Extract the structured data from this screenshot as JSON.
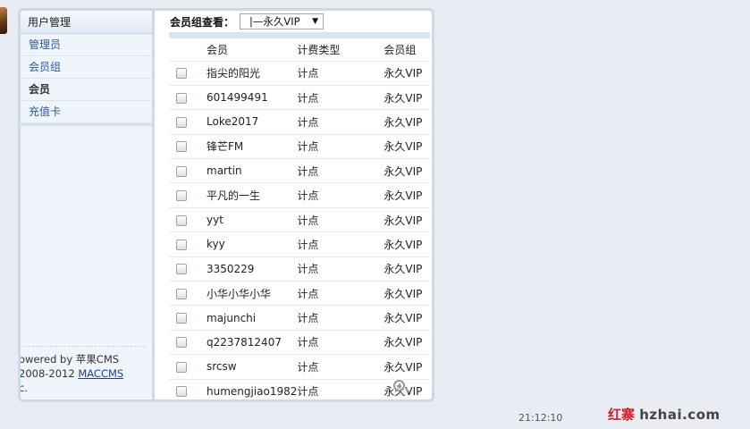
{
  "sidebar": {
    "header": "用户管理",
    "items": [
      {
        "label": "管理员",
        "active": false
      },
      {
        "label": "会员组",
        "active": false
      },
      {
        "label": "会员",
        "active": true
      },
      {
        "label": "充值卡",
        "active": false
      }
    ],
    "footer": {
      "line1": "owered by 苹果CMS",
      "line2_prefix": " 2008-2012 ",
      "line2_link": "MACCMS",
      "line3": "c."
    }
  },
  "filter": {
    "label": "会员组查看：",
    "selected": "|—永久VIP"
  },
  "table": {
    "columns": [
      "会员",
      "计费类型",
      "会员组"
    ],
    "rows": [
      [
        "指尖的阳光",
        "计点",
        "永久VIP"
      ],
      [
        "601499491",
        "计点",
        "永久VIP"
      ],
      [
        "Loke2017",
        "计点",
        "永久VIP"
      ],
      [
        "锋芒FM",
        "计点",
        "永久VIP"
      ],
      [
        "martin",
        "计点",
        "永久VIP"
      ],
      [
        "平凡的一生",
        "计点",
        "永久VIP"
      ],
      [
        "yyt",
        "计点",
        "永久VIP"
      ],
      [
        "kyy",
        "计点",
        "永久VIP"
      ],
      [
        "3350229",
        "计点",
        "永久VIP"
      ],
      [
        "小华小华小华",
        "计点",
        "永久VIP"
      ],
      [
        "majunchi",
        "计点",
        "永久VIP"
      ],
      [
        "q2237812407",
        "计点",
        "永久VIP"
      ],
      [
        "srcsw",
        "计点",
        "永久VIP"
      ],
      [
        "humengjiao1982",
        "计点",
        "永久VIP"
      ]
    ]
  },
  "status": {
    "time": "21:12:10"
  },
  "watermark": {
    "part1": "红寨",
    "part2": "hzhai.com"
  },
  "icons": {
    "zoom": "zoom-in-icon",
    "avatar": "avatar"
  }
}
